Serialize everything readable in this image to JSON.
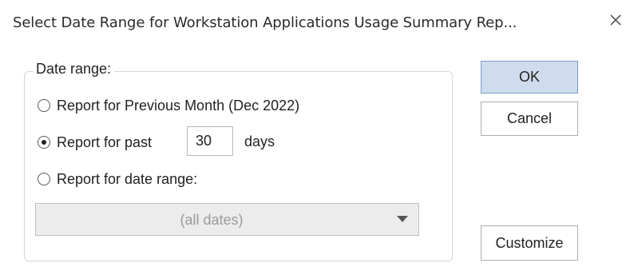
{
  "window": {
    "title": "Select Date Range for Workstation Applications Usage Summary Rep...",
    "close_glyph": "✕"
  },
  "group": {
    "legend": "Date range:"
  },
  "options": [
    {
      "label": "Report for Previous Month (Dec 2022)",
      "checked": false
    },
    {
      "label": "Report for past",
      "checked": true
    },
    {
      "label": "Report for date range:",
      "checked": false
    }
  ],
  "days": {
    "value": "30",
    "suffix": "days"
  },
  "date_select": {
    "value": "(all dates)",
    "enabled": false
  },
  "buttons": {
    "ok": "OK",
    "cancel": "Cancel",
    "customize": "Customize"
  },
  "colors": {
    "default_button_bg": "#cfdcee",
    "default_button_border": "#7a9bc9",
    "disabled_select_bg": "#ececec"
  }
}
